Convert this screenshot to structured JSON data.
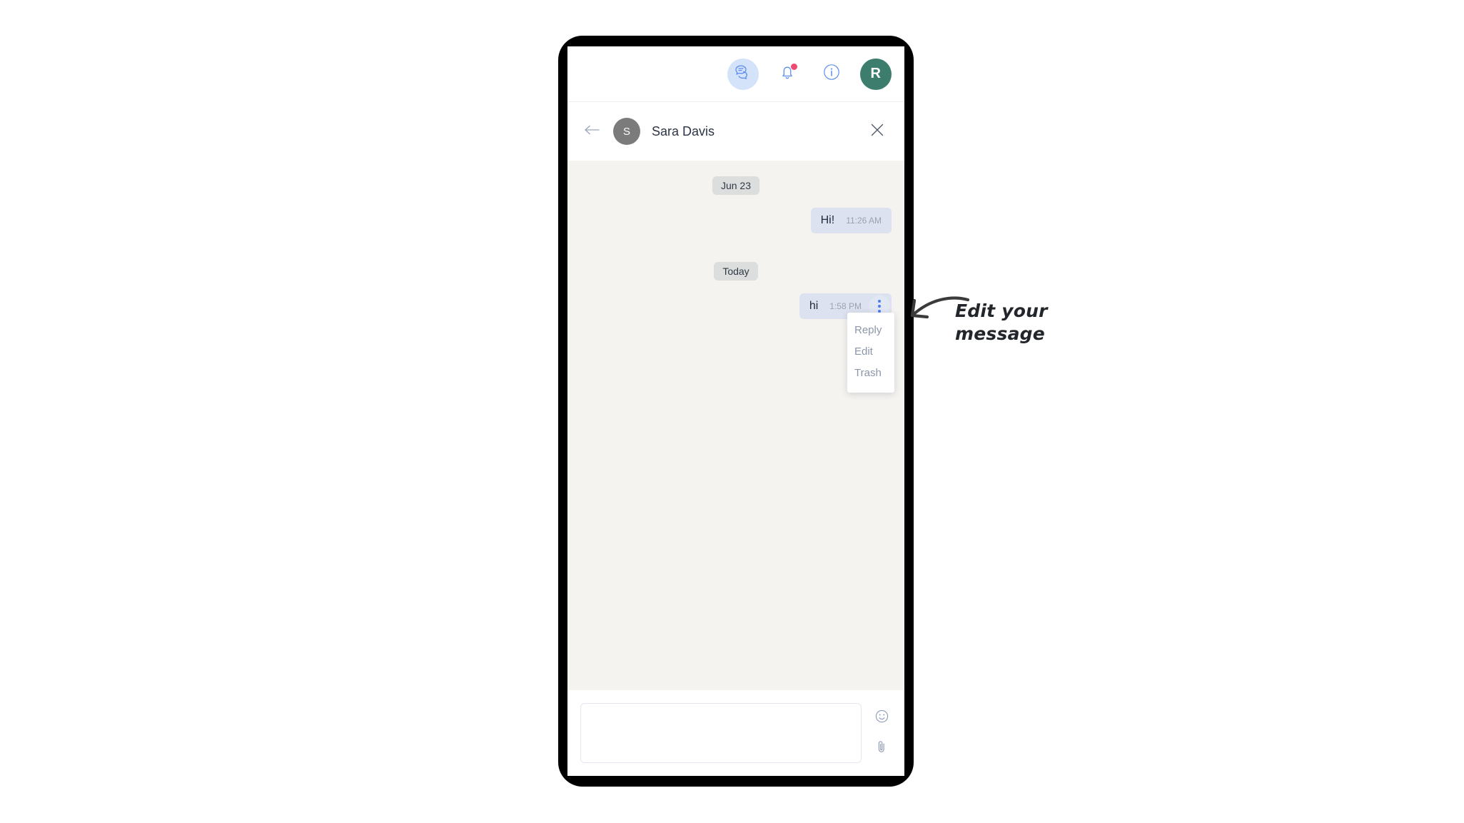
{
  "app": {
    "topbar": {
      "icons": [
        {
          "name": "chat-icon",
          "label": "Chats",
          "active": true
        },
        {
          "name": "bell-icon",
          "label": "Notifications",
          "has_badge": true
        },
        {
          "name": "info-icon",
          "label": "Info",
          "glyph": "i"
        }
      ],
      "user_avatar_initial": "R",
      "avatar_color": "#3c7d6e",
      "badge_color": "#ef4b72",
      "active_bg_color": "#d5e3fa"
    },
    "conversation": {
      "back_label": "Back",
      "contact_initial": "S",
      "contact_avatar_color": "#7b7b7b",
      "contact_name": "Sara Davis",
      "close_label": "Close"
    },
    "messages": {
      "background_color": "#f4f3ef",
      "bubble_color": "#dde2f0",
      "groups": [
        {
          "date_label": "Jun 23",
          "items": [
            {
              "text": "Hi!",
              "time": "11:26 AM",
              "outgoing": true,
              "has_menu": false
            }
          ]
        },
        {
          "date_label": "Today",
          "items": [
            {
              "text": "hi",
              "time": "1:58 PM",
              "outgoing": true,
              "has_menu": true
            }
          ]
        }
      ]
    },
    "context_menu": {
      "open": true,
      "items": [
        {
          "label": "Reply",
          "name": "menu-item-reply"
        },
        {
          "label": "Edit",
          "name": "menu-item-edit"
        },
        {
          "label": "Trash",
          "name": "menu-item-trash"
        }
      ]
    },
    "composer": {
      "value": "",
      "placeholder": "",
      "emoji_label": "Emoji",
      "attach_label": "Attach file"
    }
  },
  "annotation": {
    "line1": "Edit your",
    "line2": "message",
    "color": "#22262b"
  }
}
